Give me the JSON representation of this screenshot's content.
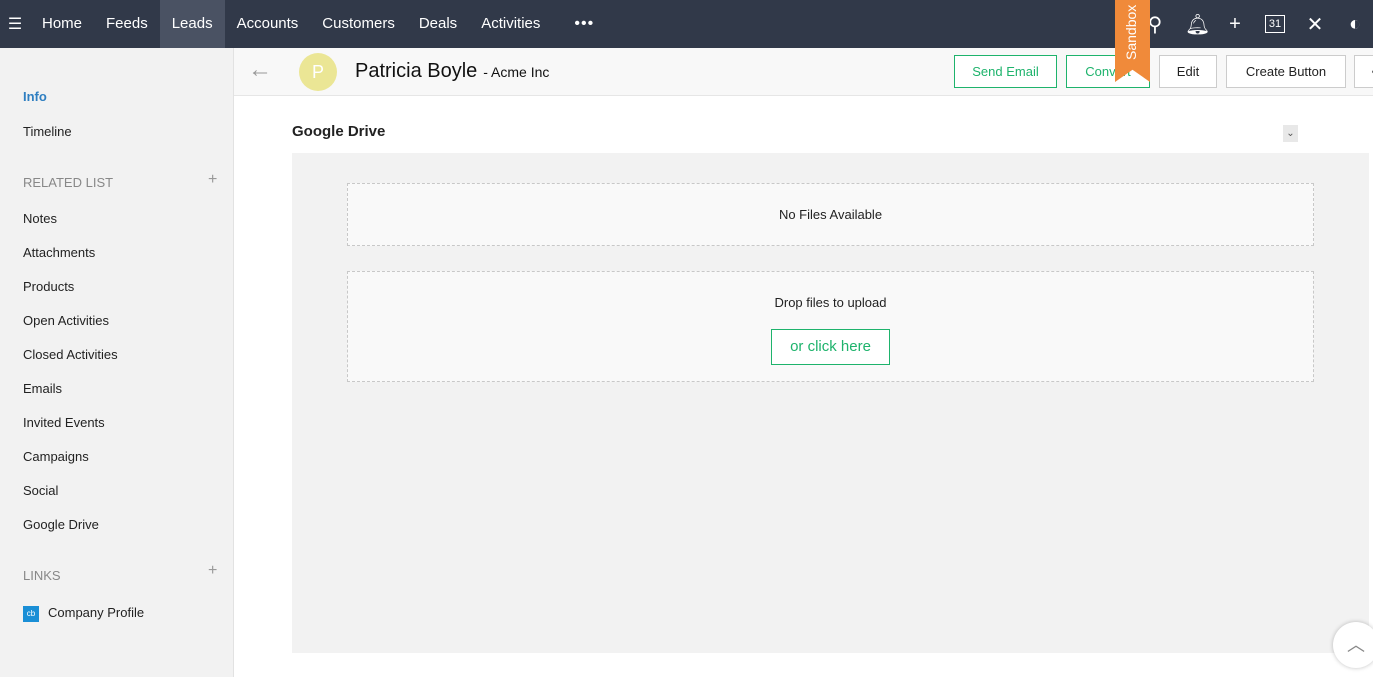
{
  "nav": {
    "items": [
      "Home",
      "Feeds",
      "Leads",
      "Accounts",
      "Customers",
      "Deals",
      "Activities"
    ],
    "more": "•••",
    "sandbox": "Sandbox"
  },
  "sidebar": {
    "info": "Info",
    "timeline": "Timeline",
    "related_header": "RELATED LIST",
    "related": [
      "Notes",
      "Attachments",
      "Products",
      "Open Activities",
      "Closed Activities",
      "Emails",
      "Invited Events",
      "Campaigns",
      "Social",
      "Google Drive"
    ],
    "links_header": "LINKS",
    "company_profile": "Company Profile",
    "cb": "cb"
  },
  "record": {
    "initial": "P",
    "name": "Patricia Boyle",
    "company": "- Acme Inc"
  },
  "actions": {
    "send_email": "Send Email",
    "convert": "Convert",
    "edit": "Edit",
    "create_button": "Create Button"
  },
  "section": {
    "title": "Google Drive",
    "no_files": "No Files Available",
    "drop": "Drop files to upload",
    "click": "or click here"
  }
}
